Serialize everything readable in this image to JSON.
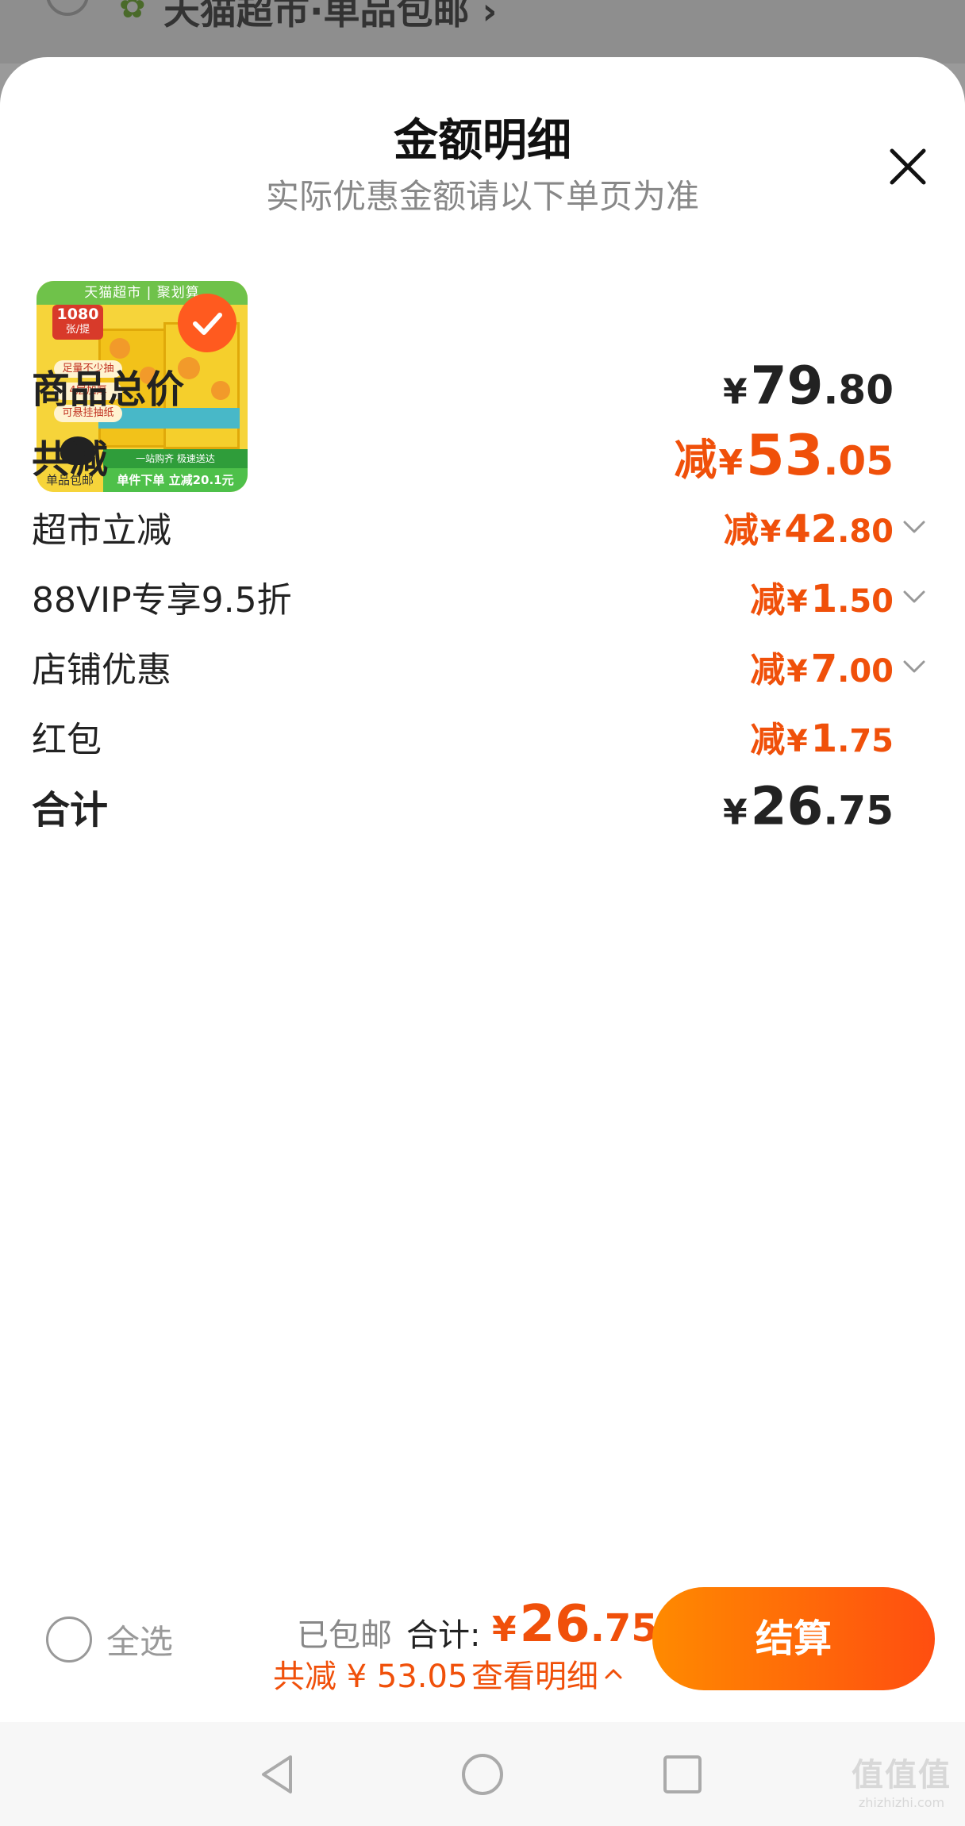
{
  "underlying_page": {
    "store_name": "天猫超市·单品包邮",
    "chevron": "›"
  },
  "sheet": {
    "title": "金额明细",
    "subtitle": "实际优惠金额请以下单页为准",
    "close_icon": "close-icon"
  },
  "product": {
    "brand_strip": "天猫超市 | 聚划算",
    "count_label": "1080",
    "count_unit": "张/提",
    "tag_1": "足量不少抽",
    "tag_2": "4层加厚",
    "tag_3": "可悬挂抽纸",
    "strip_text": "一站购齐 极速送达",
    "free_shipping_badge": "单品包邮",
    "promo_badge": "单件下单 立减20.1元",
    "selected": true
  },
  "rows": [
    {
      "label": "商品总价",
      "prefix": "",
      "yen": "¥",
      "int": "79",
      "dec": ".80",
      "style": "dark",
      "bold_label": true,
      "expandable": false
    },
    {
      "label": "共减",
      "prefix": "减",
      "yen": "¥",
      "int": "53",
      "dec": ".05",
      "style": "orange",
      "bold_label": true,
      "expandable": false
    },
    {
      "label": "超市立减",
      "prefix": "减",
      "yen": "¥",
      "int": "42",
      "dec": ".80",
      "style": "orange",
      "bold_label": false,
      "expandable": true
    },
    {
      "label": "88VIP专享9.5折",
      "prefix": "减",
      "yen": "¥",
      "int": "1",
      "dec": ".50",
      "style": "orange",
      "bold_label": false,
      "expandable": true
    },
    {
      "label": "店铺优惠",
      "prefix": "减",
      "yen": "¥",
      "int": "7",
      "dec": ".00",
      "style": "orange",
      "bold_label": false,
      "expandable": true
    },
    {
      "label": "红包",
      "prefix": "减",
      "yen": "¥",
      "int": "1",
      "dec": ".75",
      "style": "orange",
      "bold_label": false,
      "expandable": false
    },
    {
      "label": "合计",
      "prefix": "",
      "yen": "¥",
      "int": "26",
      "dec": ".75",
      "style": "dark",
      "bold_label": true,
      "expandable": false
    }
  ],
  "bottom_bar": {
    "select_all_label": "全选",
    "shipping_text": "已包邮",
    "total_label": "合计:",
    "total_yen": "¥",
    "total_int": "26",
    "total_dec": ".75",
    "saved_text": "共减 ¥ 53.05",
    "detail_link": "查看明细",
    "checkout_label": "结算"
  },
  "nav_bar": {
    "back_icon": "back-triangle-icon",
    "home_icon": "home-circle-icon",
    "recents_icon": "recents-square-icon"
  },
  "watermark": {
    "logo": "值值值",
    "url": "zhizhizhi.com"
  },
  "colors": {
    "accent_orange": "#f0500a",
    "checkout_gradient_start": "#ff8a00",
    "checkout_gradient_end": "#ff4e10",
    "text_dark": "#222222",
    "text_gray": "#888888"
  }
}
